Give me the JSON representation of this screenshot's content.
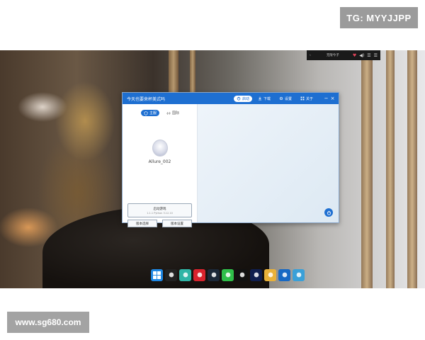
{
  "overlay": {
    "tg_label": "TG: MYYJJPP",
    "site_label": "www.sg680.com"
  },
  "window": {
    "title": "今天也要来杯美式吗",
    "tabs": [
      {
        "label": "启动",
        "icon": "power-icon",
        "active": true
      },
      {
        "label": "下载",
        "icon": "download-icon",
        "active": false
      },
      {
        "label": "设置",
        "icon": "gear-icon",
        "active": false
      },
      {
        "label": "关于",
        "icon": "grid-icon",
        "active": false
      }
    ],
    "minimize_glyph": "−",
    "close_glyph": "×"
  },
  "left_panel": {
    "subtabs": [
      {
        "label": "主服",
        "icon": "shield-icon",
        "active": true
      },
      {
        "label": "国际",
        "icon": "link-icon",
        "active": false
      }
    ],
    "username": "Allure_002",
    "launch": {
      "title": "启动游戏",
      "subtitle": "1.1.1 Python 3.12.10"
    },
    "buttons": [
      "版本选择",
      "版本设置"
    ]
  },
  "music_widget": {
    "song": "无限今子",
    "controls": [
      "♥",
      "◀)",
      "☰",
      "☰"
    ]
  },
  "taskbar": {
    "icons": [
      {
        "name": "windows-start-icon",
        "color": "#1e88e5"
      },
      {
        "name": "piano-icon",
        "color": "#222222"
      },
      {
        "name": "edge-browser-icon",
        "color": "#2fb5a6"
      },
      {
        "name": "netease-music-icon",
        "color": "#d9232d"
      },
      {
        "name": "steam-icon",
        "color": "#1b2838"
      },
      {
        "name": "wechat-icon",
        "color": "#2fbf4a"
      },
      {
        "name": "qq-icon",
        "color": "#111111"
      },
      {
        "name": "photoshop-icon",
        "color": "#0f1e4f"
      },
      {
        "name": "app-icon",
        "color": "#e8b13a"
      },
      {
        "name": "screen-capture-icon",
        "color": "#1769c4"
      },
      {
        "name": "game-icon",
        "color": "#3aa0d8"
      }
    ]
  },
  "colors": {
    "accent": "#1e6fd1"
  }
}
